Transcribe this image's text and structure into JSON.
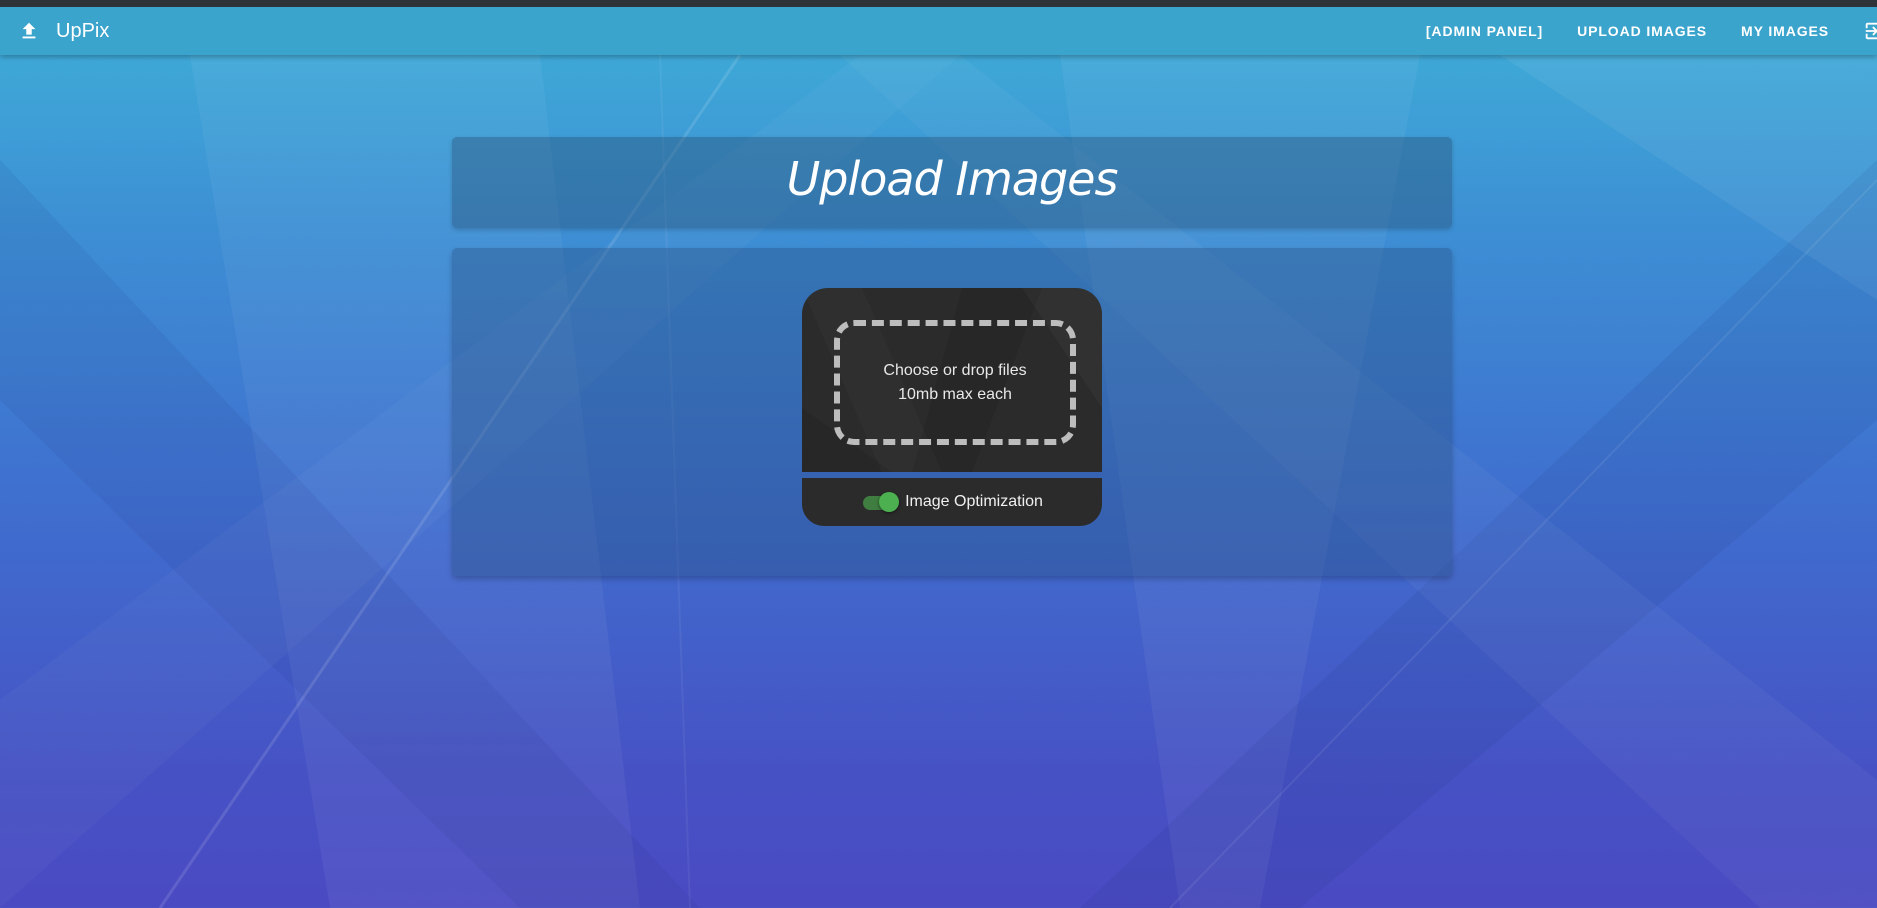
{
  "app": {
    "brand": "UpPix"
  },
  "navbar": {
    "upload_icon": "upload-icon",
    "links": [
      {
        "label": "[ADMIN PANEL]"
      },
      {
        "label": "UPLOAD IMAGES"
      },
      {
        "label": "MY IMAGES"
      }
    ],
    "logout_icon": "logout-icon"
  },
  "page": {
    "title": "Upload Images"
  },
  "uploader": {
    "drop_text_line1": "Choose or drop files",
    "drop_text_line2": "10mb max each",
    "optimization": {
      "label": "Image Optimization",
      "enabled": true
    }
  },
  "colors": {
    "navbar": "#3ba4cc",
    "toggle_on": "#4caf50",
    "panel": "#2b2b2b"
  }
}
